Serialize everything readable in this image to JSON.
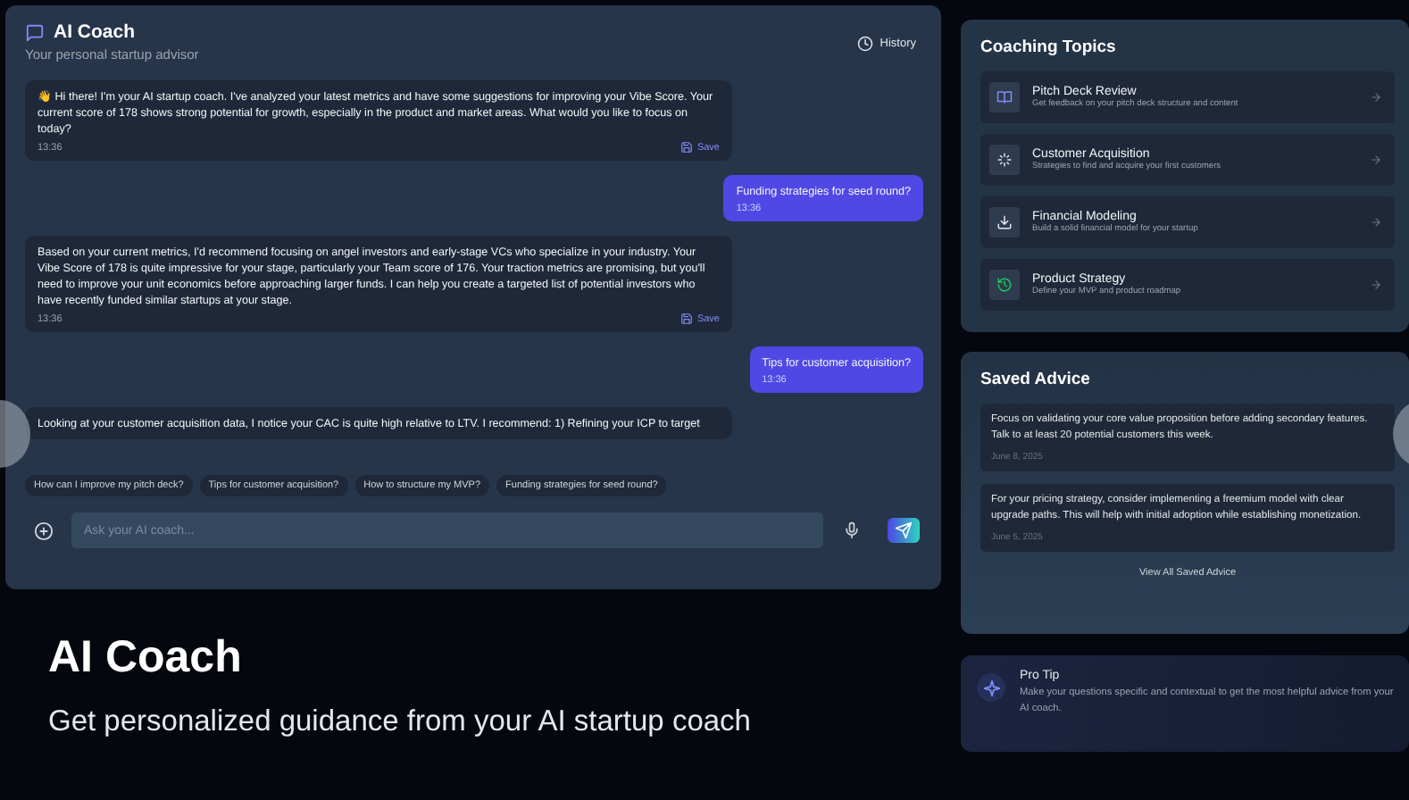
{
  "chat": {
    "title": "AI Coach",
    "subtitle": "Your personal startup advisor",
    "history_button": "History",
    "messages": [
      {
        "kind": "assistant",
        "text": "👋 Hi there! I'm your AI startup coach. I've analyzed your latest metrics and have some suggestions for improving your Vibe Score. Your current score of 178 shows strong potential for growth, especially in the product and market areas. What would you like to focus on today?",
        "time": "13:36",
        "save_label": "Save"
      },
      {
        "kind": "user",
        "text": "Funding strategies for seed round?",
        "time": "13:36"
      },
      {
        "kind": "assistant",
        "text": "Based on your current metrics, I'd recommend focusing on angel investors and early-stage VCs who specialize in your industry. Your Vibe Score of 178 is quite impressive for your stage, particularly your Team score of 176. Your traction metrics are promising, but you'll need to improve your unit economics before approaching larger funds. I can help you create a targeted list of potential investors who have recently funded similar startups at your stage.",
        "time": "13:36",
        "save_label": "Save"
      },
      {
        "kind": "user",
        "text": "Tips for customer acquisition?",
        "time": "13:36"
      },
      {
        "kind": "assistant",
        "text": "Looking at your customer acquisition data, I notice your CAC is quite high relative to LTV. I recommend: 1) Refining your ICP to target"
      }
    ],
    "suggestions": [
      "How can I improve my pitch deck?",
      "Tips for customer acquisition?",
      "How to structure my MVP?",
      "Funding strategies for seed round?"
    ],
    "input": {
      "placeholder": "Ask your AI coach..."
    }
  },
  "hero": {
    "title": "AI Coach",
    "subtitle": "Get personalized guidance from your AI startup coach"
  },
  "coaching_topics": {
    "title": "Coaching Topics",
    "items": [
      {
        "title": "Pitch Deck Review",
        "description": "Get feedback on your pitch deck structure and content"
      },
      {
        "title": "Customer Acquisition",
        "description": "Strategies to find and acquire your first customers"
      },
      {
        "title": "Financial Modeling",
        "description": "Build a solid financial model for your startup"
      },
      {
        "title": "Product Strategy",
        "description": "Define your MVP and product roadmap"
      }
    ]
  },
  "saved_advice": {
    "title": "Saved Advice",
    "items": [
      {
        "text": "Focus on validating your core value proposition before adding secondary features. Talk to at least 20 potential customers this week.",
        "date": "June 8, 2025"
      },
      {
        "text": "For your pricing strategy, consider implementing a freemium model with clear upgrade paths. This will help with initial adoption while establishing monetization.",
        "date": "June 5, 2025"
      }
    ],
    "view_all": "View All Saved Advice"
  },
  "pro_tip": {
    "title": "Pro Tip",
    "text": "Make your questions specific and contextual to get the most helpful advice from your AI coach."
  }
}
